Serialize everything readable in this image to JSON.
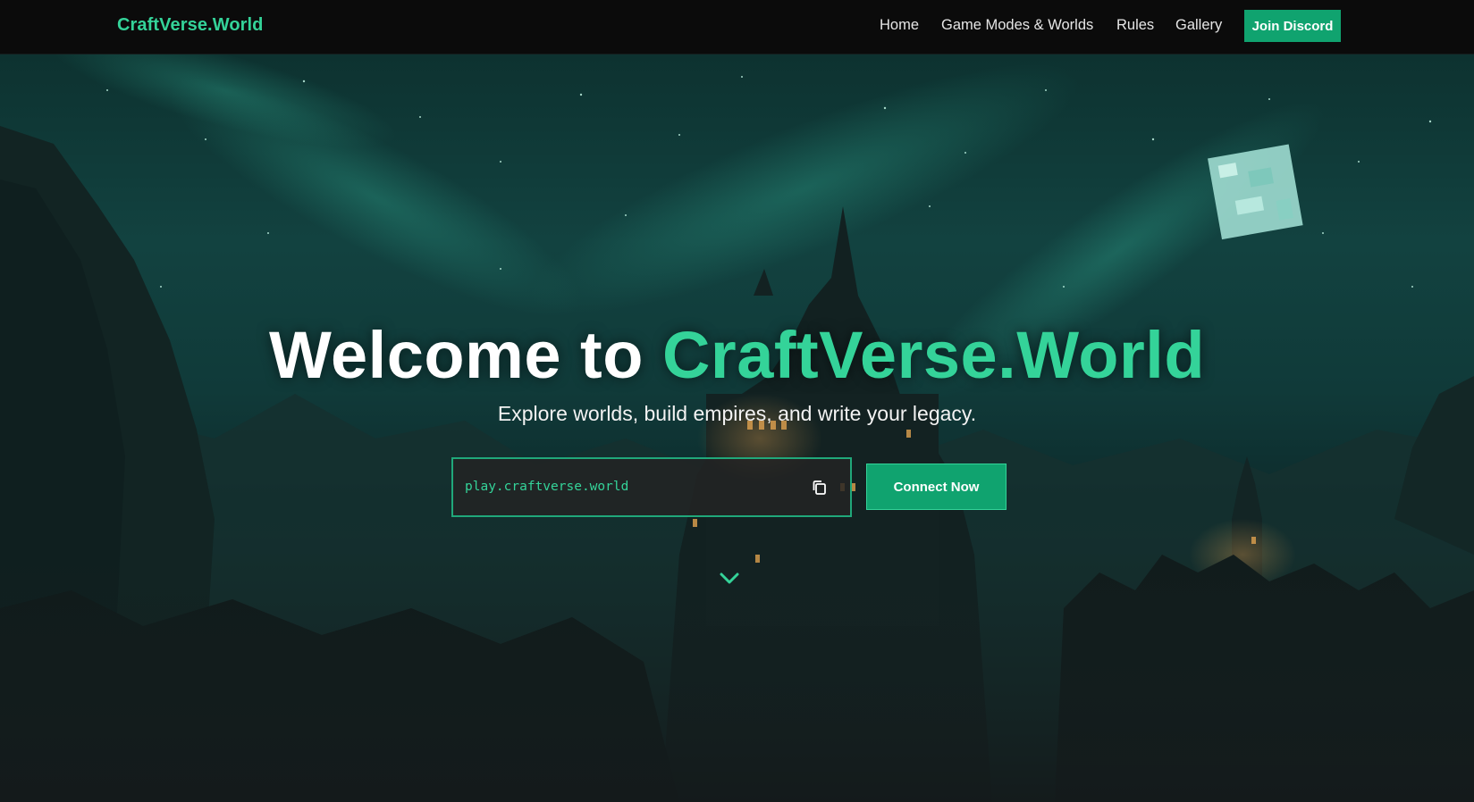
{
  "nav": {
    "brand": "CraftVerse.World",
    "links": [
      "Home",
      "Game Modes & Worlds",
      "Rules",
      "Gallery"
    ],
    "discord_label": "Join Discord"
  },
  "hero": {
    "title_prefix": "Welcome to ",
    "title_accent": "CraftVerse.World",
    "subtitle": "Explore worlds, build empires, and write your legacy.",
    "server_ip": "play.craftverse.world",
    "connect_label": "Connect Now"
  },
  "icons": {
    "copy": "copy-icon",
    "scroll": "chevron-down-icon"
  },
  "colors": {
    "accent": "#34d399",
    "button": "#10a36f",
    "navbar": "#0b0b0b"
  }
}
